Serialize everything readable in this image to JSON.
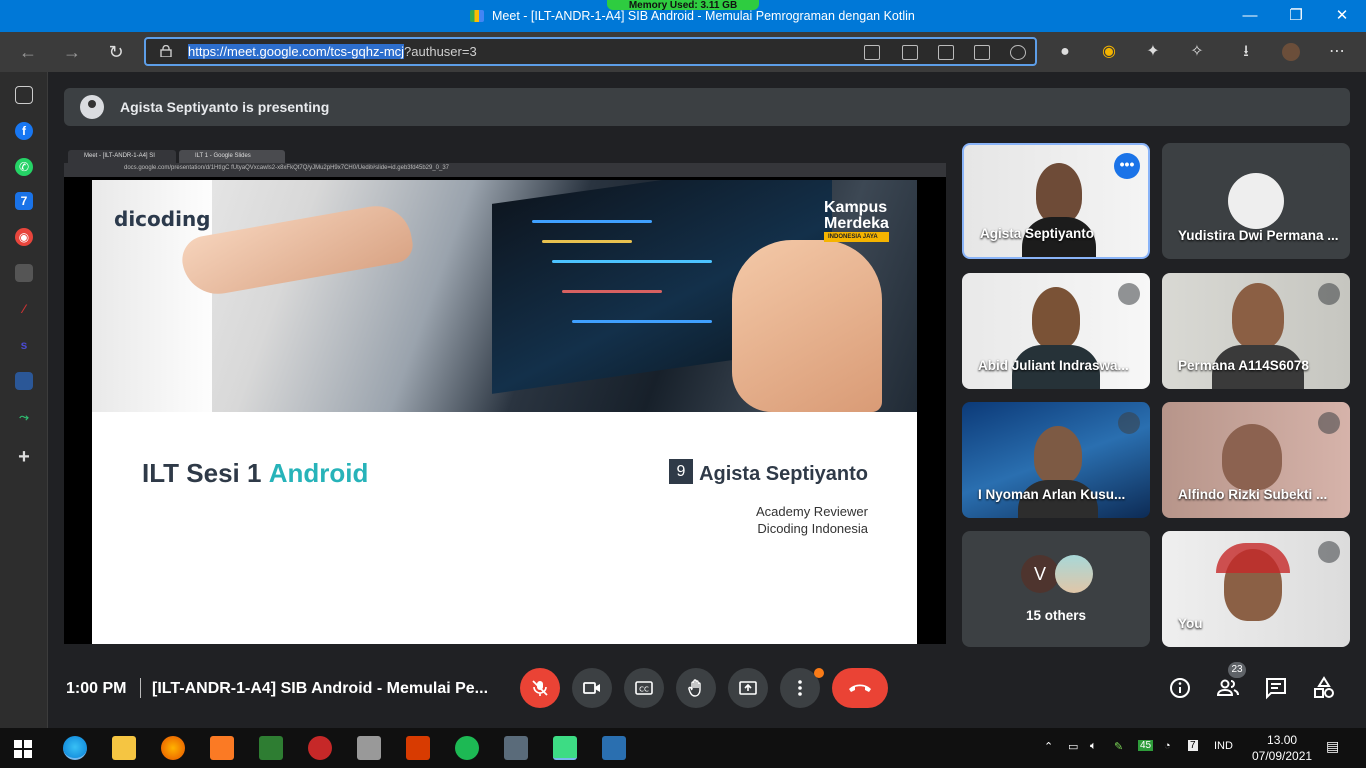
{
  "window": {
    "memory": "Memory Used: 3.11 GB",
    "title": "Meet - [ILT-ANDR-1-A4] SIB Android - Memulai Pemrograman dengan Kotlin"
  },
  "browser": {
    "url_selected": "https://meet.google.com/tcs-gqhz-mcj",
    "url_rest": "?authuser=3"
  },
  "banner": {
    "text": "Agista Septiyanto is presenting"
  },
  "presentation": {
    "tabs": [
      "Meet - [ILT-ANDR-1-A4] SI",
      "ILT 1 - Google Slides"
    ],
    "address": "docs.google.com/presentation/d/1HtIgC fUtyaQVxcawls2-x8xFkQt7Q/yJMu2pH9x7CH0/Uedit#slide=id.geb3fd45b29_0_37",
    "brand": "dicoding",
    "kampus": "Kampus",
    "merdeka": "Merdeka",
    "kampus_sub": "INDONESIA JAYA",
    "title_main": "ILT Sesi 1 ",
    "title_accent": "Android",
    "badge": "9",
    "presenter": "Agista Septiyanto",
    "role": "Academy Reviewer",
    "org": "Dicoding Indonesia"
  },
  "participants": [
    {
      "name": "Agista Septiyanto"
    },
    {
      "name": "Yudistira Dwi Permana ..."
    },
    {
      "name": "Abid Juliant Indraswa..."
    },
    {
      "name": "Permana A114S6078"
    },
    {
      "name": "I Nyoman Arlan Kusu..."
    },
    {
      "name": "Alfindo Rizki Subekti ..."
    },
    {
      "name": "15 others",
      "initial": "V"
    },
    {
      "name": "You"
    }
  ],
  "bottom": {
    "time": "1:00 PM",
    "meeting_title": "[ILT-ANDR-1-A4] SIB Android - Memulai Pe...",
    "people_count": "23"
  },
  "taskbar": {
    "badge": "45",
    "lang": "IND",
    "time": "13.00",
    "date": "07/09/2021"
  }
}
